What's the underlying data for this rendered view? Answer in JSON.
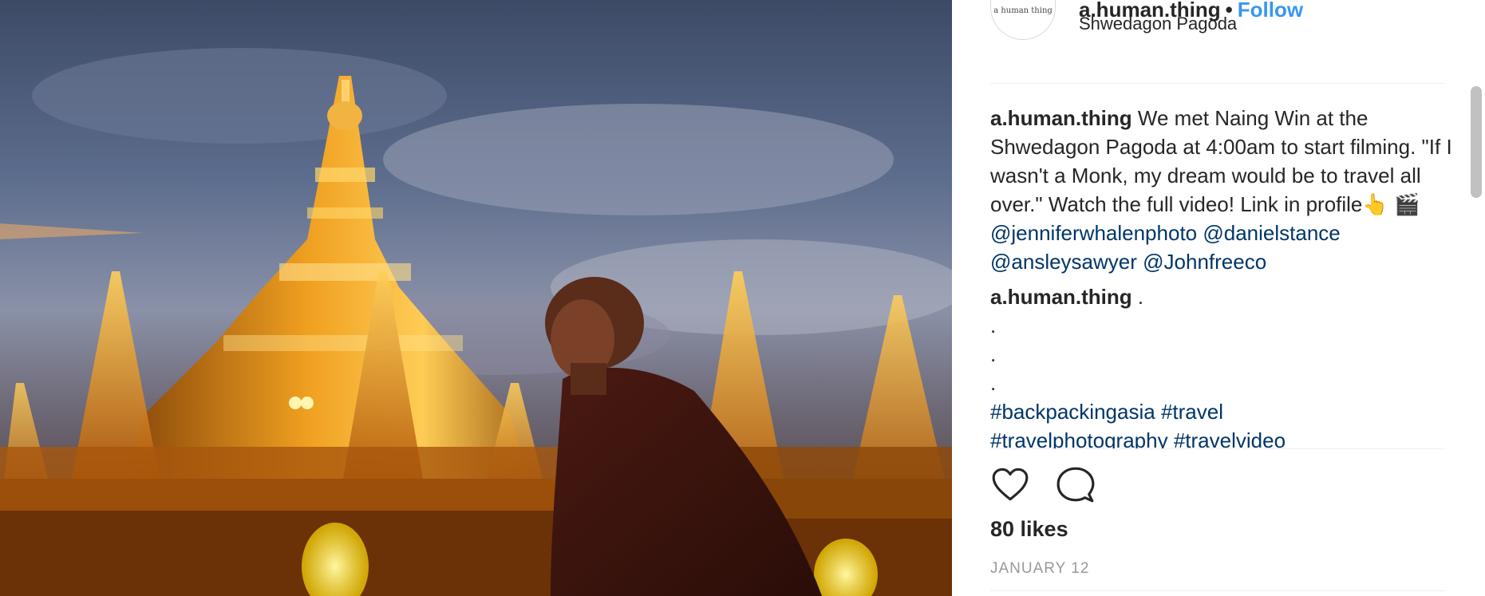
{
  "post": {
    "image_alt": "Monk walking past the golden Shwedagon Pagoda at dusk",
    "avatar_text": "a human thing",
    "username": "a.human.thing",
    "separator": "•",
    "follow_label": "Follow",
    "location": "Shwedagon Pagoda"
  },
  "caption": {
    "user": "a.human.thing",
    "text": "We met Naing Win at the Shwedagon Pagoda at 4:00am to start filming. \"If I wasn't a Monk, my dream would be to travel all over.\" Watch the full video! Link in profile👆 🎬 ",
    "mentions": [
      "@jenniferwhalenphoto",
      "@danielstance",
      "@ansleysawyer",
      "@Johnfreeco"
    ]
  },
  "comment2": {
    "user": "a.human.thing",
    "text": ".",
    "dots": [
      ".",
      ".",
      "."
    ],
    "hashtags": [
      "#backpackingasia",
      "#travel",
      "#travelphotography",
      "#travelvideo"
    ]
  },
  "footer": {
    "like_icon": "heart-icon",
    "comment_icon": "comment-bubble-icon",
    "likes": "80 likes",
    "date": "JANUARY 12"
  },
  "colors": {
    "link": "#003569",
    "follow": "#3897f0",
    "muted": "#999999"
  }
}
